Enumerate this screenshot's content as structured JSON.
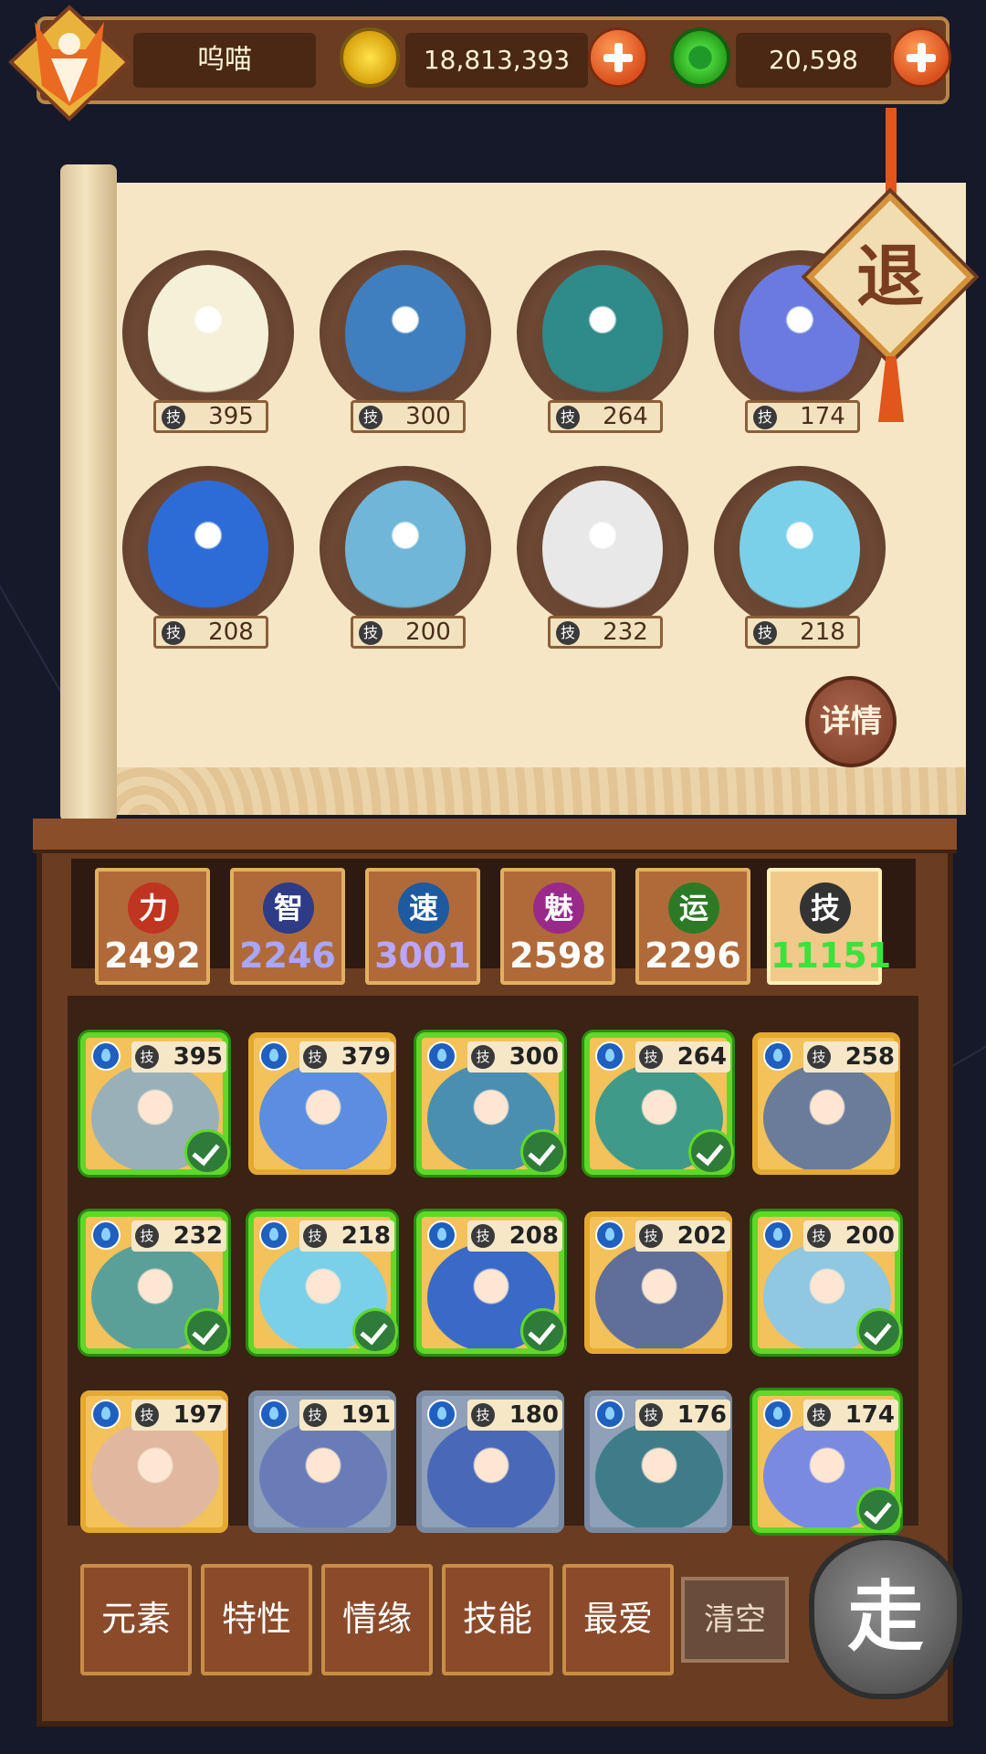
{
  "header": {
    "player_name": "呜喵",
    "gold": "18,813,393",
    "jade": "20,598"
  },
  "lineup": {
    "slots": [
      {
        "name": "mahjong-tile",
        "skill": "395"
      },
      {
        "name": "hero-wave-rider",
        "skill": "300"
      },
      {
        "name": "hero-golden-crown",
        "skill": "264"
      },
      {
        "name": "hero-blue-flower",
        "skill": "174"
      },
      {
        "name": "hero-blue-mermaid",
        "skill": "208"
      },
      {
        "name": "hero-water-spirit",
        "skill": "200"
      },
      {
        "name": "hero-archer-horse",
        "skill": "232"
      },
      {
        "name": "hero-book-reader",
        "skill": "218"
      }
    ],
    "exit_label": "退",
    "detail_label": "详情"
  },
  "stats": [
    {
      "icon": "力",
      "value": "2492",
      "color": "#ffffff",
      "badge": "#c0351f"
    },
    {
      "icon": "智",
      "value": "2246",
      "color": "#a9a6ff",
      "badge": "#2e3b86"
    },
    {
      "icon": "速",
      "value": "3001",
      "color": "#b9a6ff",
      "badge": "#1e5aa0"
    },
    {
      "icon": "魅",
      "value": "2598",
      "color": "#ffffff",
      "badge": "#9a2a8a"
    },
    {
      "icon": "运",
      "value": "2296",
      "color": "#ffffff",
      "badge": "#2d7a26"
    },
    {
      "icon": "技",
      "value": "11151",
      "color": "#3ce23c",
      "badge": "#333333"
    }
  ],
  "skill_icon_label": "技",
  "heroes": [
    {
      "skill": "395",
      "selected": true,
      "tone": "gold",
      "color": "#9ab0b8"
    },
    {
      "skill": "379",
      "selected": false,
      "tone": "gold",
      "color": "#5b8de0"
    },
    {
      "skill": "300",
      "selected": true,
      "tone": "gold",
      "color": "#4a8fb0"
    },
    {
      "skill": "264",
      "selected": true,
      "tone": "gold",
      "color": "#3f9a8a"
    },
    {
      "skill": "258",
      "selected": false,
      "tone": "gold",
      "color": "#6a7c9a"
    },
    {
      "skill": "232",
      "selected": true,
      "tone": "gold",
      "color": "#5aa098"
    },
    {
      "skill": "218",
      "selected": true,
      "tone": "gold",
      "color": "#7ad0e8"
    },
    {
      "skill": "208",
      "selected": true,
      "tone": "gold",
      "color": "#3a6ac8"
    },
    {
      "skill": "202",
      "selected": false,
      "tone": "gold",
      "color": "#5f6f9a"
    },
    {
      "skill": "200",
      "selected": true,
      "tone": "gold",
      "color": "#8fc8e0"
    },
    {
      "skill": "197",
      "selected": false,
      "tone": "gold",
      "color": "#e0b8a0"
    },
    {
      "skill": "191",
      "selected": false,
      "tone": "grey",
      "color": "#6a7cb8"
    },
    {
      "skill": "180",
      "selected": false,
      "tone": "grey",
      "color": "#4a68b8"
    },
    {
      "skill": "176",
      "selected": false,
      "tone": "grey",
      "color": "#3f7c8a"
    },
    {
      "skill": "174",
      "selected": true,
      "tone": "gold",
      "color": "#7a8ae0"
    }
  ],
  "filters": [
    "元素",
    "特性",
    "情缘",
    "技能",
    "最爱"
  ],
  "clear_label": "清空",
  "go_label": "走"
}
